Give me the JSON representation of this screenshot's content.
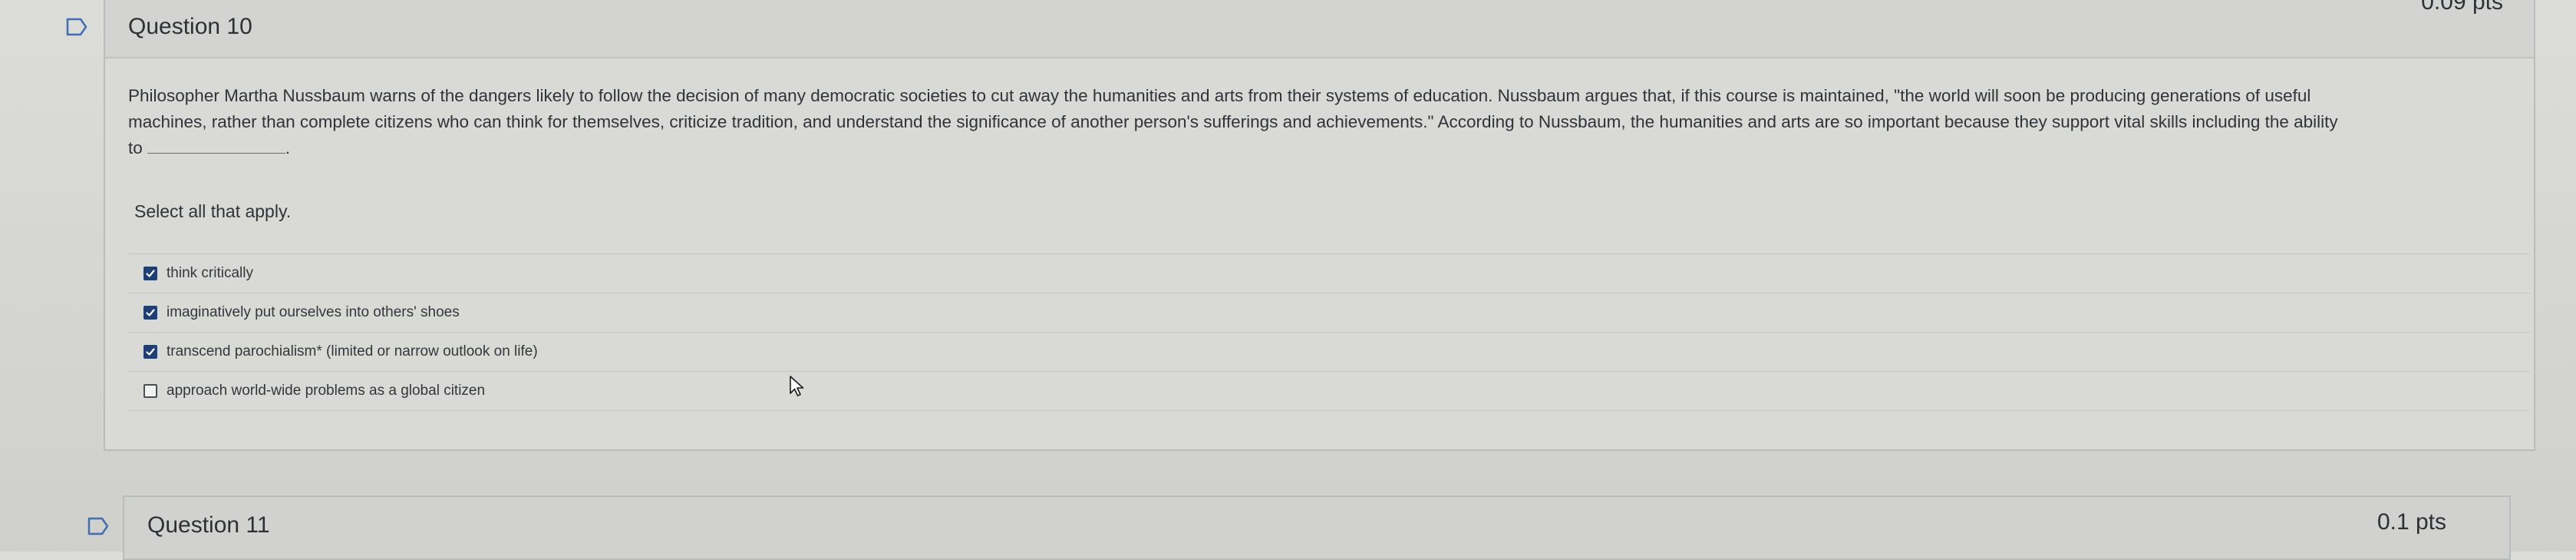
{
  "question10": {
    "title": "Question 10",
    "points": "0.09 pts",
    "prompt_line1": "Philosopher Martha Nussbaum warns of the dangers likely to follow the decision of many democratic societies to cut away the humanities and arts from their systems of education. Nussbaum argues that, if this course is maintained, \"the world will soon be producing generations of useful",
    "prompt_line2": "machines, rather than complete citizens who can think for themselves, criticize tradition, and understand the significance of another person's sufferings and achievements.\" According to Nussbaum, the humanities and arts are so important because they support vital skills including the ability",
    "prompt_line3": "to",
    "prompt_line3_end": ".",
    "instruction": "Select all that apply.",
    "answers": [
      {
        "label": "think critically",
        "checked": true
      },
      {
        "label": "imaginatively put ourselves into others' shoes",
        "checked": true
      },
      {
        "label": "transcend parochialism* (limited or narrow outlook on life)",
        "checked": true
      },
      {
        "label": "approach world-wide problems as a global citizen",
        "checked": false
      }
    ]
  },
  "question11": {
    "title": "Question 11",
    "points": "0.1 pts"
  },
  "icons": {
    "flag": "flag-icon",
    "cursor": "mouse-pointer-icon",
    "check": "checkmark-icon"
  },
  "colors": {
    "checkbox_checked": "#1d3f78",
    "background": "#d9d9d6"
  }
}
